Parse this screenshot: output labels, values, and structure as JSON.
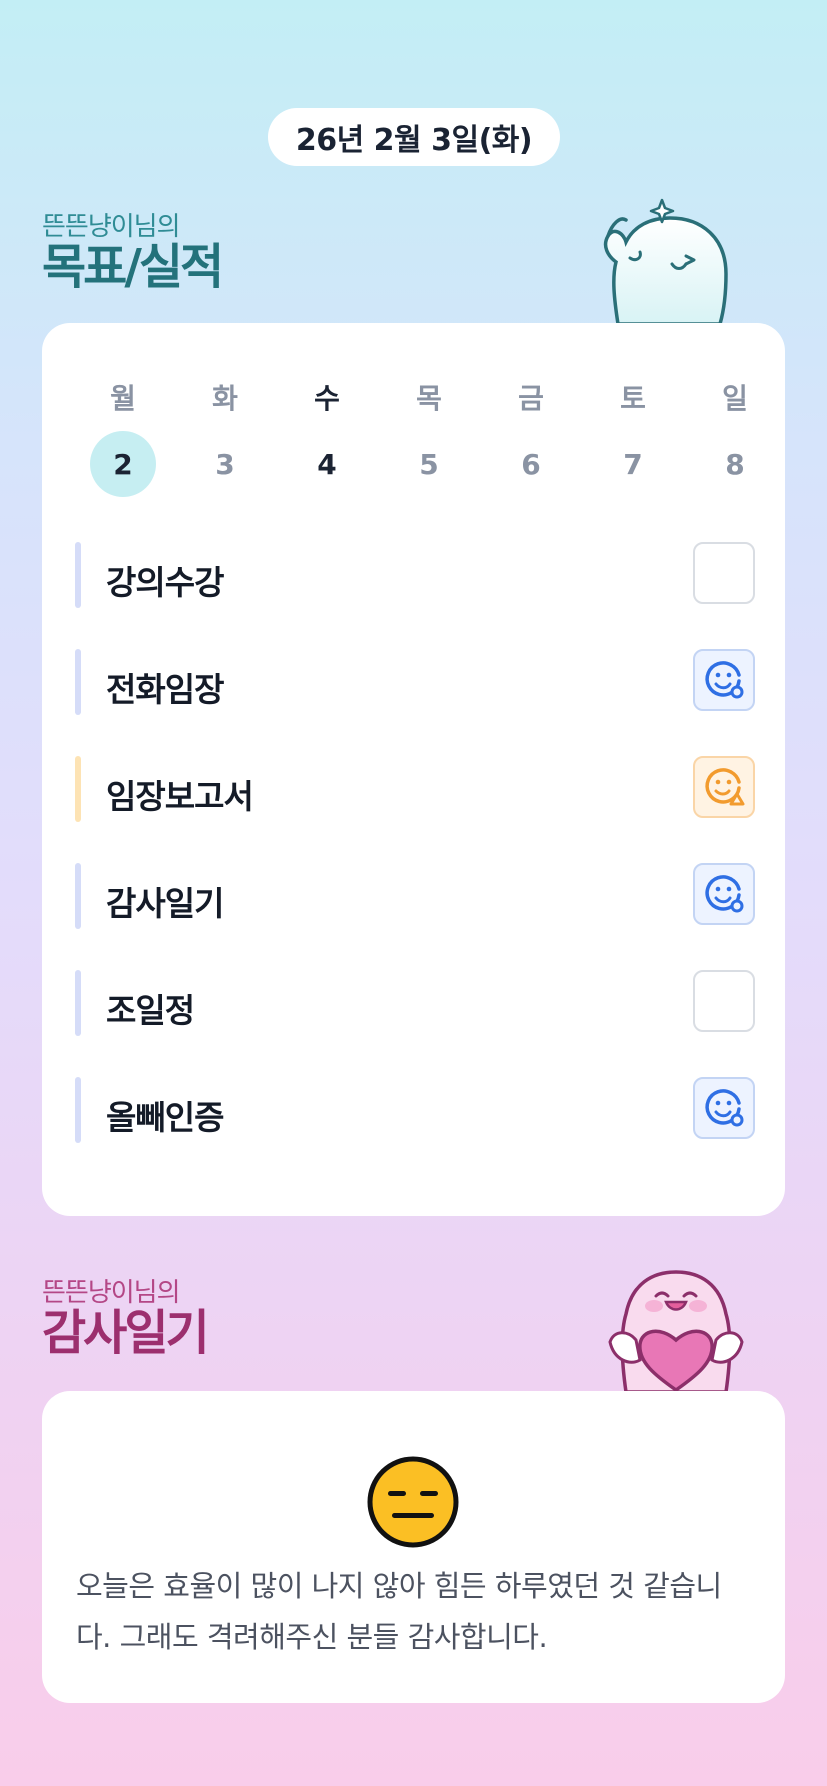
{
  "header": {
    "date": "26년 2월 3일(화)"
  },
  "goals_section": {
    "owner_line": "뜬뜬냥이님의",
    "title": "목표/실적"
  },
  "week": {
    "weekdays": [
      "월",
      "화",
      "수",
      "목",
      "금",
      "토",
      "일"
    ],
    "dates": [
      "2",
      "3",
      "4",
      "5",
      "6",
      "7",
      "8"
    ],
    "selected_index": 0,
    "today_index": 2
  },
  "tasks": [
    {
      "label": "강의수강",
      "status": "empty"
    },
    {
      "label": "전화임장",
      "status": "done"
    },
    {
      "label": "임장보고서",
      "status": "partial"
    },
    {
      "label": "감사일기",
      "status": "done"
    },
    {
      "label": "조일정",
      "status": "empty"
    },
    {
      "label": "올빼인증",
      "status": "done"
    }
  ],
  "gratitude_section": {
    "owner_line": "뜬뜬냥이님의",
    "title": "감사일기",
    "mood": "neutral-face-icon",
    "text": "오늘은 효율이 많이 나지 않아 힘든 하루였던 것 같습니다. 그래도 격려해주신 분들 감사합니다."
  },
  "colors": {
    "accent_teal": "#23727b",
    "accent_pink": "#9c2f6e",
    "done_blue": "#2f6fe4",
    "partial_orange": "#f29b2e",
    "selected_date_bg": "#c6eef2"
  }
}
